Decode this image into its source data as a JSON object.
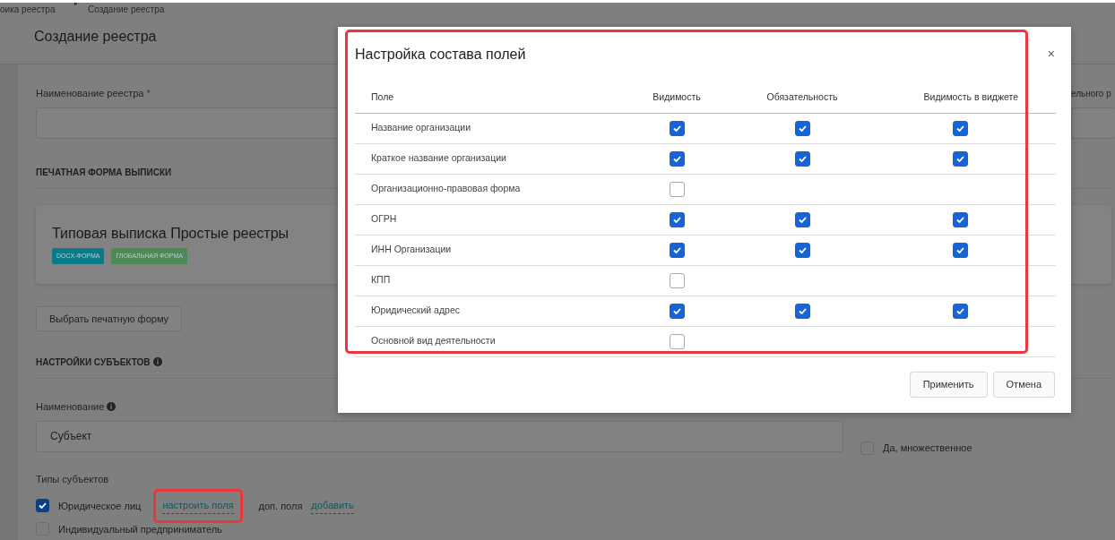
{
  "breadcrumb": {
    "parent": "оика реестра",
    "separator": "▸",
    "current": "Создание реестра"
  },
  "page_title": "Создание реестра",
  "registry_name": {
    "label": "Наименование реестра",
    "required_mark": "*"
  },
  "right_label": "ельного р",
  "print_form": {
    "heading": "ПЕЧАТНАЯ ФОРМА ВЫПИСКИ",
    "card_title": "Типовая выписка Простые реестры",
    "tags": [
      {
        "text": "DOCX-ФОРМА",
        "color": "#0a7b86"
      },
      {
        "text": "ГЛОБАЛЬНАЯ ФОРМА",
        "color": "#4e8a55"
      }
    ],
    "button": "Выбрать печатную форму"
  },
  "subjects": {
    "heading": "НАСТРОЙКИ СУБЪЕКТОВ",
    "name_label": "Наименование",
    "name_value": "Субъект",
    "multiple": {
      "label": "Да, множественное",
      "checked": false
    },
    "types_label": "Типы субъектов",
    "types": [
      {
        "label": "Юридическое лиц",
        "checked": true,
        "links": [
          {
            "kind": "link",
            "text": "настроить поля"
          },
          {
            "kind": "text",
            "text": "доп. поля"
          },
          {
            "kind": "link",
            "text": "добавить"
          }
        ]
      },
      {
        "label": "Индивидуальный предприниматель",
        "checked": false
      }
    ]
  },
  "modal": {
    "title": "Настройка состава полей",
    "close": "×",
    "columns": [
      "Поле",
      "Видимость",
      "Обязательность",
      "Видимость в виджете"
    ],
    "rows": [
      {
        "label": "Название организации",
        "visible": true,
        "required": true,
        "widget": true
      },
      {
        "label": "Краткое название организации",
        "visible": true,
        "required": true,
        "widget": true
      },
      {
        "label": "Организационно-правовая форма",
        "visible": false
      },
      {
        "label": "ОГРН",
        "visible": true,
        "required": true,
        "widget": true
      },
      {
        "label": "ИНН Организации",
        "visible": true,
        "required": true,
        "widget": true
      },
      {
        "label": "КПП",
        "visible": false
      },
      {
        "label": "Юридический адрес",
        "visible": true,
        "required": true,
        "widget": true
      },
      {
        "label": "Основной вид деятельности",
        "visible": false
      }
    ],
    "buttons": [
      "Применить",
      "Отмена"
    ]
  }
}
